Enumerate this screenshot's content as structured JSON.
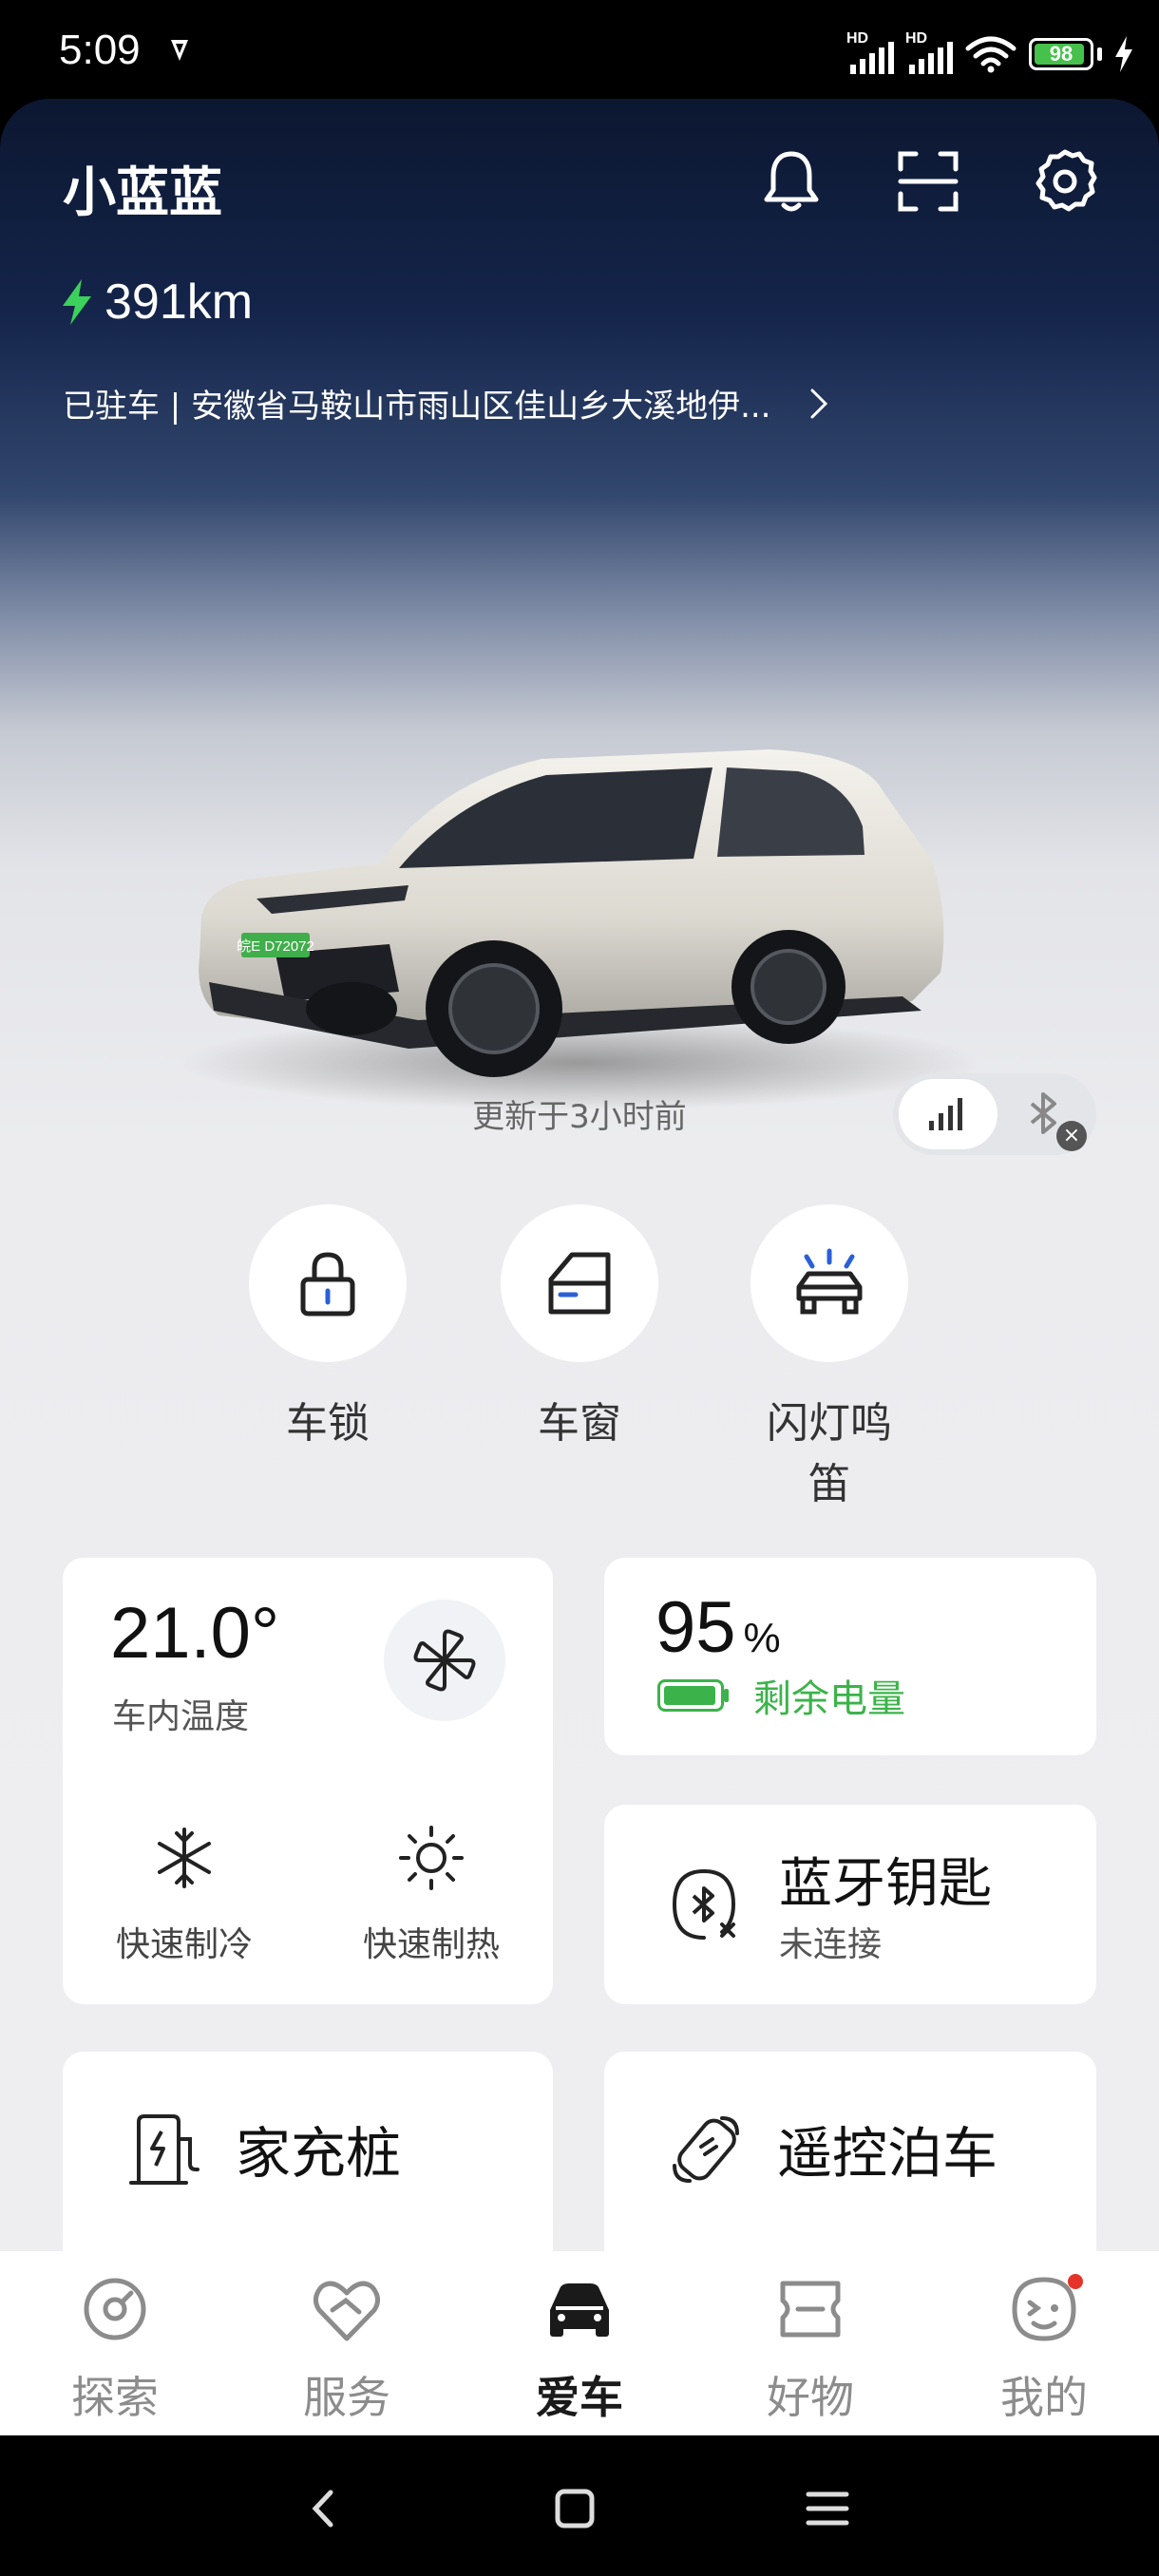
{
  "status_bar": {
    "time": "5:09",
    "network_label": "HD",
    "battery": "98"
  },
  "header": {
    "title": "小蓝蓝",
    "icons": [
      "bell-icon",
      "scan-icon",
      "gear-icon"
    ]
  },
  "vehicle": {
    "range": "391km",
    "location": "已驻车 | 安徽省马鞍山市雨山区佳山乡大溪地伊...",
    "plate": "皖E D72072",
    "updated": "更新于3小时前"
  },
  "controls": [
    {
      "label": "车锁",
      "icon": "lock-icon"
    },
    {
      "label": "车窗",
      "icon": "window-icon"
    },
    {
      "label": "闪灯鸣笛",
      "icon": "flash-horn-icon"
    }
  ],
  "climate": {
    "temperature": "21.0°",
    "temperature_label": "车内温度",
    "quick_cool": "快速制冷",
    "quick_heat": "快速制热"
  },
  "battery": {
    "value": "95",
    "unit": "%",
    "label": "剩余电量",
    "level": 0.95
  },
  "bluetooth_key": {
    "title": "蓝牙钥匙",
    "status": "未连接"
  },
  "home_charger": {
    "label": "家充桩"
  },
  "remote_parking": {
    "label": "遥控泊车"
  },
  "tabs": [
    {
      "label": "探索",
      "icon": "explore-icon"
    },
    {
      "label": "服务",
      "icon": "service-icon"
    },
    {
      "label": "爱车",
      "icon": "car-icon",
      "active": true
    },
    {
      "label": "好物",
      "icon": "ticket-icon"
    },
    {
      "label": "我的",
      "icon": "profile-icon",
      "badge": true
    }
  ],
  "colors": {
    "accent_green": "#3bb34a",
    "badge_red": "#e5332a"
  }
}
